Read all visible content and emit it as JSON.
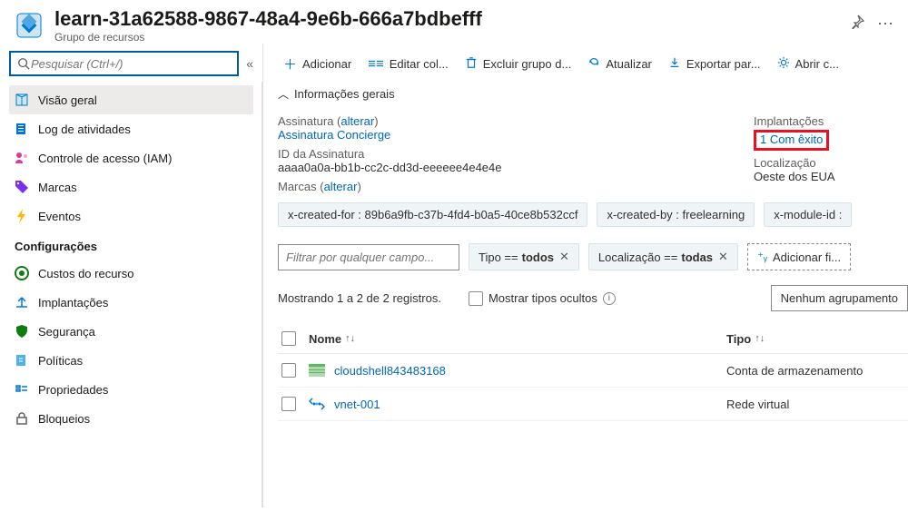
{
  "header": {
    "title": "learn-31a62588-9867-48a4-9e6b-666a7bdbefff",
    "subtitle": "Grupo de recursos"
  },
  "search": {
    "placeholder": "Pesquisar (Ctrl+/)"
  },
  "sidebar": {
    "items": [
      {
        "label": "Visão geral",
        "icon": "cube"
      },
      {
        "label": "Log de atividades",
        "icon": "log"
      },
      {
        "label": "Controle de acesso (IAM)",
        "icon": "iam"
      },
      {
        "label": "Marcas",
        "icon": "tag"
      },
      {
        "label": "Eventos",
        "icon": "bolt"
      }
    ],
    "section": "Configurações",
    "items2": [
      {
        "label": "Custos do recurso",
        "icon": "cost"
      },
      {
        "label": "Implantações",
        "icon": "deploy"
      },
      {
        "label": "Segurança",
        "icon": "shield"
      },
      {
        "label": "Políticas",
        "icon": "policy"
      },
      {
        "label": "Propriedades",
        "icon": "props"
      },
      {
        "label": "Bloqueios",
        "icon": "lock"
      }
    ]
  },
  "toolbar": {
    "add": "Adicionar",
    "edit": "Editar col...",
    "delete": "Excluir grupo d...",
    "refresh": "Atualizar",
    "export": "Exportar par...",
    "opencs": "Abrir c..."
  },
  "essentials": {
    "header": "Informações gerais",
    "sub_label": "Assinatura",
    "alterar": "alterar",
    "sub_value": "Assinatura Concierge",
    "subid_label": "ID da Assinatura",
    "subid_value": "aaaa0a0a-bb1b-cc2c-dd3d-eeeeee4e4e4e",
    "tags_label": "Marcas",
    "deploy_label": "Implantações",
    "deploy_value": "1 Com êxito",
    "loc_label": "Localização",
    "loc_value": "Oeste dos EUA"
  },
  "tags": [
    "x-created-for : 89b6a9fb-c37b-4fd4-b0a5-40ce8b532ccf",
    "x-created-by : freelearning",
    "x-module-id :"
  ],
  "filters": {
    "filter_placeholder": "Filtrar por qualquer campo...",
    "type_prefix": "Tipo == ",
    "type_value": "todos",
    "loc_prefix": "Localização == ",
    "loc_value": "todas",
    "add": "Adicionar fi..."
  },
  "table_meta": {
    "count": "Mostrando 1 a 2 de 2 registros.",
    "show_hidden": "Mostrar tipos ocultos",
    "grouping": "Nenhum agrupamento"
  },
  "columns": {
    "name": "Nome",
    "type": "Tipo"
  },
  "rows": [
    {
      "name": "cloudshell843483168",
      "type": "Conta de armazenamento",
      "icon": "storage"
    },
    {
      "name": "vnet-001",
      "type": "Rede virtual",
      "icon": "vnet"
    }
  ]
}
